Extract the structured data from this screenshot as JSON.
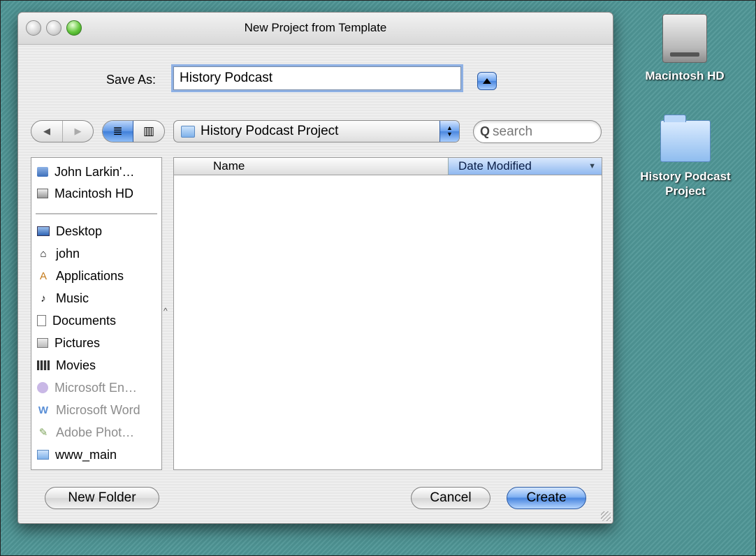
{
  "window": {
    "title": "New Project from Template"
  },
  "save_as": {
    "label": "Save As:",
    "value": "History Podcast"
  },
  "toolbar": {
    "back_glyph": "◀",
    "forward_glyph": "▶",
    "list_view_glyph": "≣",
    "column_view_glyph": "▥",
    "current_folder": "History Podcast Project",
    "search_placeholder": "search",
    "search_glyph": "Q"
  },
  "sidebar": {
    "devices": [
      {
        "label": "John Larkin'…",
        "icon": "computer-icon"
      },
      {
        "label": "Macintosh HD",
        "icon": "hard-drive-icon"
      }
    ],
    "places": [
      {
        "label": "Desktop",
        "icon": "desktop-icon",
        "dim": false
      },
      {
        "label": "john",
        "icon": "home-icon",
        "dim": false
      },
      {
        "label": "Applications",
        "icon": "applications-icon",
        "dim": false
      },
      {
        "label": "Music",
        "icon": "music-icon",
        "dim": false
      },
      {
        "label": "Documents",
        "icon": "documents-icon",
        "dim": false
      },
      {
        "label": "Pictures",
        "icon": "pictures-icon",
        "dim": false
      },
      {
        "label": "Movies",
        "icon": "movies-icon",
        "dim": false
      },
      {
        "label": "Microsoft En…",
        "icon": "microsoft-entourage-icon",
        "dim": true
      },
      {
        "label": "Microsoft Word",
        "icon": "microsoft-word-icon",
        "dim": true
      },
      {
        "label": "Adobe Phot…",
        "icon": "adobe-photoshop-icon",
        "dim": true
      },
      {
        "label": "www_main",
        "icon": "folder-icon",
        "dim": false
      }
    ]
  },
  "file_list": {
    "columns": [
      "Name",
      "Date Modified"
    ],
    "sorted_column": "Date Modified",
    "rows": []
  },
  "buttons": {
    "new_folder": "New Folder",
    "cancel": "Cancel",
    "create": "Create"
  },
  "desktop": {
    "icons": [
      {
        "label": "Macintosh HD",
        "icon": "hard-drive-icon"
      },
      {
        "label": "History Podcast Project",
        "icon": "folder-icon"
      }
    ]
  },
  "colors": {
    "desktop_background": "#4f9696",
    "aqua_blue": "#4b87df"
  }
}
